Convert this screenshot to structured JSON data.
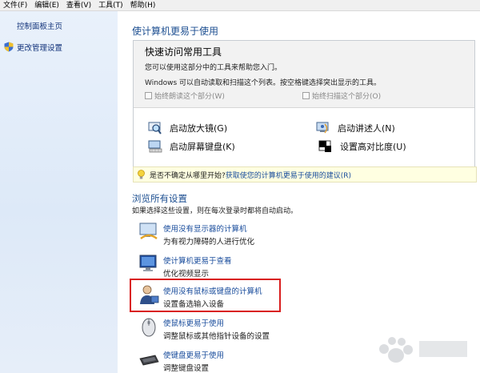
{
  "menubar": {
    "items": [
      "文件(F)",
      "编辑(E)",
      "查看(V)",
      "工具(T)",
      "帮助(H)"
    ]
  },
  "sidebar": {
    "items": [
      {
        "label": "控制面板主页"
      },
      {
        "label": "更改管理设置",
        "icon": "shield-icon"
      }
    ]
  },
  "main": {
    "title": "使计算机更易于使用",
    "quick_access": {
      "title": "快速访问常用工具",
      "line1": "您可以使用这部分中的工具来帮助您入门。",
      "line2": "Windows 可以自动读取和扫描这个列表。按空格键选择突出显示的工具。",
      "checkbox_read": "始终朗读这个部分(W)",
      "checkbox_scan": "始终扫描这个部分(O)",
      "tools": [
        {
          "label": "启动放大镜(G)",
          "icon": "magnifier-icon"
        },
        {
          "label": "启动讲述人(N)",
          "icon": "narrator-icon"
        },
        {
          "label": "启动屏幕键盘(K)",
          "icon": "onscreen-keyboard-icon"
        },
        {
          "label": "设置高对比度(U)",
          "icon": "high-contrast-icon"
        }
      ]
    },
    "hint": {
      "text": "是否不确定从哪里开始?",
      "link": "获取使您的计算机更易于使用的建议(R)"
    },
    "browse": {
      "title": "浏览所有设置",
      "desc": "如果选择这些设置，则在每次登录时都将自动启动。",
      "entries": [
        {
          "link": "使用没有显示器的计算机",
          "desc": "为有视力障碍的人进行优化",
          "icon": "speech-display-icon"
        },
        {
          "link": "使计算机更易于查看",
          "desc": "优化视频显示",
          "icon": "monitor-icon"
        },
        {
          "link": "使用没有鼠标或键盘的计算机",
          "desc": "设置备选输入设备",
          "icon": "user-input-icon"
        },
        {
          "link": "使鼠标更易于使用",
          "desc": "调整鼠标或其他指针设备的设置",
          "icon": "mouse-icon"
        },
        {
          "link": "使键盘更易于使用",
          "desc": "调整键盘设置",
          "icon": "keyboard-icon"
        }
      ]
    }
  },
  "colors": {
    "link": "#1a4d9c",
    "heading": "#1d4f91",
    "highlight": "#d91e1e",
    "sidebar_bg": "#dde9f8",
    "hint_bg": "#ffffe1"
  }
}
